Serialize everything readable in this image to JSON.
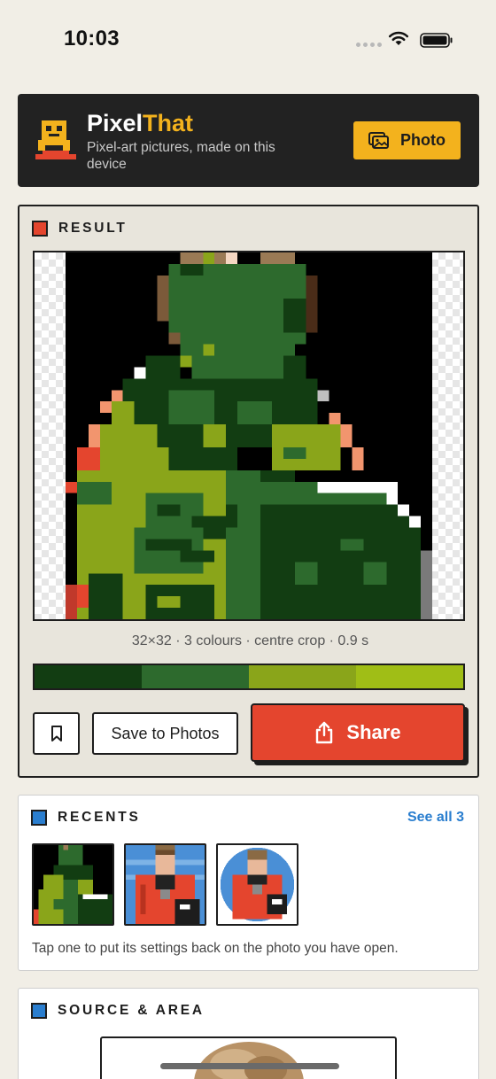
{
  "status_bar": {
    "time": "10:03"
  },
  "header": {
    "brand_first": "Pixel",
    "brand_second": "That",
    "tagline": "Pixel-art pictures, made on this device",
    "photo_button": "Photo"
  },
  "result": {
    "section_title": "RESULT",
    "meta": "32×32 · 3 colours · centre crop · 0.9 s",
    "palette": [
      "#123d12",
      "#2d6a2d",
      "#8aa51a",
      "#a0be16"
    ],
    "save_button": "Save to Photos",
    "share_button": "Share"
  },
  "recents": {
    "section_title": "RECENTS",
    "see_all": "See all 3",
    "hint": "Tap one to put its settings back on the photo you have open."
  },
  "source": {
    "section_title": "SOURCE & AREA"
  },
  "colors": {
    "background": "#f1eee6",
    "header_bg": "#222222",
    "accent_yellow": "#f3b21d",
    "accent_red": "#e4452e",
    "accent_blue": "#2a7ecf"
  }
}
